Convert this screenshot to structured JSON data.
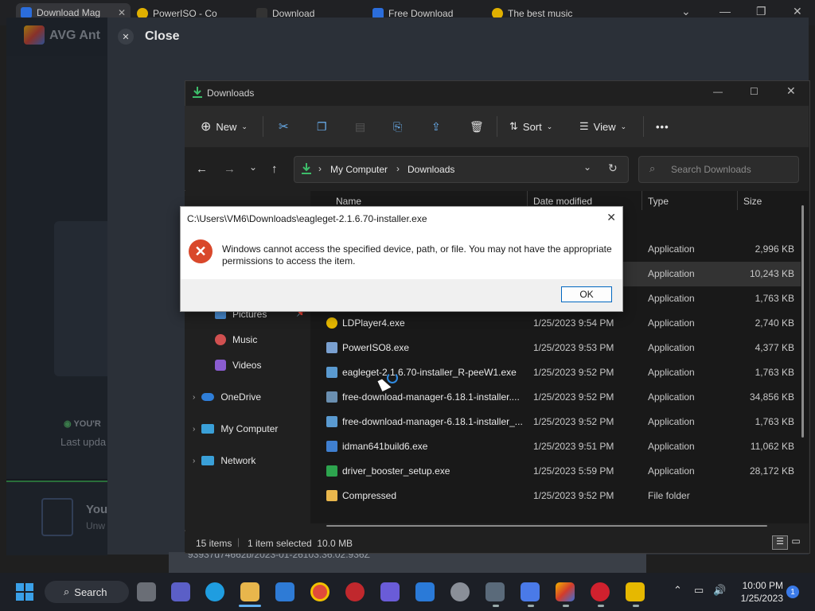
{
  "browser": {
    "tabs": [
      {
        "label": "Download Mag",
        "color": "#2b6ddb"
      },
      {
        "label": "PowerISO - Co",
        "color": "#e0b000"
      },
      {
        "label": "Download",
        "color": "#333333"
      },
      {
        "label": "Free Download",
        "color": "#2b6ddb"
      },
      {
        "label": "The best music",
        "color": "#e0b000"
      }
    ]
  },
  "avg": {
    "title": "AVG Ant",
    "close_label": "Close",
    "status_text": "YOU'R",
    "last_update": "Last upda",
    "promo_title": "You",
    "promo_sub": "Unw",
    "footer_id": "93937d74662b/2023-01-26103.36.02.936Z"
  },
  "explorer": {
    "title": "Downloads",
    "toolbar": {
      "new_label": "New",
      "sort_label": "Sort",
      "view_label": "View",
      "more_label": "•••"
    },
    "breadcrumb": [
      "My Computer",
      "Downloads"
    ],
    "search_placeholder": "Search Downloads",
    "columns": {
      "name": "Name",
      "date": "Date modified",
      "type": "Type",
      "size": "Size"
    },
    "nav": [
      {
        "label": "Pictures",
        "icon": "pictures-icon",
        "color": "#4a90d9"
      },
      {
        "label": "Music",
        "icon": "music-icon",
        "color": "#d05050"
      },
      {
        "label": "Videos",
        "icon": "videos-icon",
        "color": "#8a5cd0"
      },
      {
        "label": "OneDrive",
        "icon": "onedrive-icon",
        "color": "#2f7ed8"
      },
      {
        "label": "My Computer",
        "icon": "computer-icon",
        "color": "#3aa0d8"
      },
      {
        "label": "Network",
        "icon": "network-icon",
        "color": "#3aa0d8"
      }
    ],
    "rows": [
      {
        "name": "",
        "date": "",
        "type": "Application",
        "size": "2,996 KB",
        "icon_color": "#888888"
      },
      {
        "name": "",
        "date": "",
        "type": "Application",
        "size": "10,243 KB",
        "icon_color": "#888888"
      },
      {
        "name": "",
        "date": "",
        "type": "Application",
        "size": "1,763 KB",
        "icon_color": "#888888"
      },
      {
        "name": "LDPlayer4.exe",
        "date": "1/25/2023 9:54 PM",
        "type": "Application",
        "size": "2,740 KB",
        "icon_color": "#e6b800"
      },
      {
        "name": "PowerISO8.exe",
        "date": "1/25/2023 9:53 PM",
        "type": "Application",
        "size": "4,377 KB",
        "icon_color": "#7aa0d0"
      },
      {
        "name": "eagleget-2.1.6.70-installer_R-peeW1.exe",
        "date": "1/25/2023 9:52 PM",
        "type": "Application",
        "size": "1,763 KB",
        "icon_color": "#5a9ad0"
      },
      {
        "name": "free-download-manager-6.18.1-installer....",
        "date": "1/25/2023 9:52 PM",
        "type": "Application",
        "size": "34,856 KB",
        "icon_color": "#6a8fb0"
      },
      {
        "name": "free-download-manager-6.18.1-installer_...",
        "date": "1/25/2023 9:52 PM",
        "type": "Application",
        "size": "1,763 KB",
        "icon_color": "#5a9ad0"
      },
      {
        "name": "idman641build6.exe",
        "date": "1/25/2023 9:51 PM",
        "type": "Application",
        "size": "11,062 KB",
        "icon_color": "#3f7fd0"
      },
      {
        "name": "driver_booster_setup.exe",
        "date": "1/25/2023 5:59 PM",
        "type": "Application",
        "size": "28,172 KB",
        "icon_color": "#2da44e"
      },
      {
        "name": "Compressed",
        "date": "1/25/2023 9:52 PM",
        "type": "File folder",
        "size": "",
        "icon_color": "#e8b64c"
      }
    ],
    "status": {
      "items": "15 items",
      "selected": "1 item selected  10.0 MB"
    }
  },
  "dialog": {
    "title": "C:\\Users\\VM6\\Downloads\\eagleget-2.1.6.70-installer.exe",
    "message": "Windows cannot access the specified device, path, or file. You may not have the appropriate permissions to access the item.",
    "ok_label": "OK"
  },
  "taskbar": {
    "search_label": "Search",
    "time": "10:00 PM",
    "date": "1/25/2023",
    "notification_count": "1"
  },
  "colors": {
    "accent": "#0067c0",
    "error": "#d9482b"
  }
}
